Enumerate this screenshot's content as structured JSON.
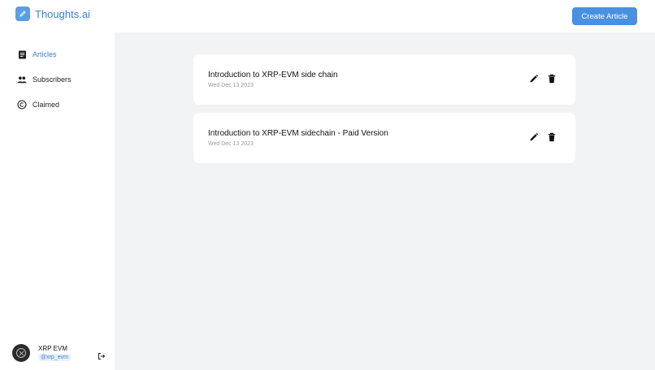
{
  "brand": {
    "name": "Thoughts.ai",
    "icon": "pencil-icon"
  },
  "header": {
    "create_label": "Create Article"
  },
  "sidebar": {
    "items": [
      {
        "label": "Articles",
        "icon": "article-icon",
        "active": true
      },
      {
        "label": "Subscribers",
        "icon": "people-icon",
        "active": false
      },
      {
        "label": "Claimed",
        "icon": "copyright-icon",
        "active": false
      }
    ]
  },
  "user": {
    "name": "XRP EVM",
    "handle": "@xrp_evm",
    "logout_icon": "logout-icon"
  },
  "articles": [
    {
      "title": "Introduction to XRP-EVM side chain",
      "date": "Wed Dec 13 2023"
    },
    {
      "title": "Introduction to XRP-EVM sidechain - Paid Version",
      "date": "Wed Dec 13 2023"
    }
  ],
  "colors": {
    "accent": "#4a90e2",
    "link": "#3b82d6",
    "main_bg": "#f2f3f5"
  }
}
